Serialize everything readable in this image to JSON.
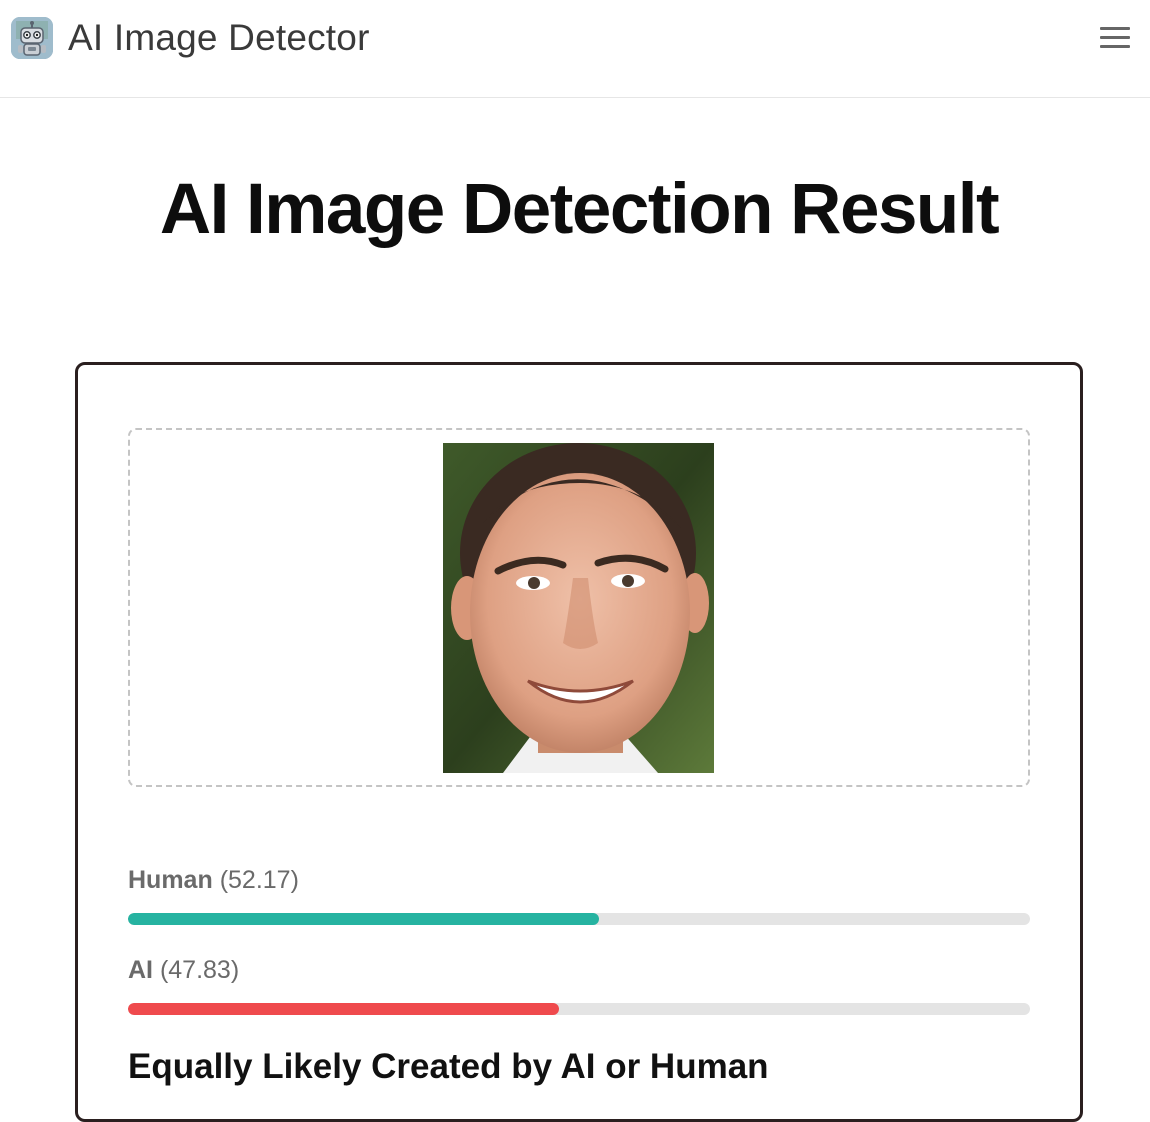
{
  "app": {
    "name": "AI Image Detector",
    "logo_icon": "robot-icon",
    "menu_icon": "hamburger-menu-icon"
  },
  "page": {
    "title": "AI Image Detection Result"
  },
  "upload": {
    "image_alt": "uploaded face photo"
  },
  "results": [
    {
      "label": "Human",
      "score_text": "(52.17)",
      "score": 52.17,
      "color": "#26b3a1"
    },
    {
      "label": "AI",
      "score_text": "(47.83)",
      "score": 47.83,
      "color": "#ef4a4d"
    }
  ],
  "verdict": "Equally Likely Created by AI or Human",
  "colors": {
    "track": "#e4e4e4",
    "card_border": "#2a1f1f"
  }
}
